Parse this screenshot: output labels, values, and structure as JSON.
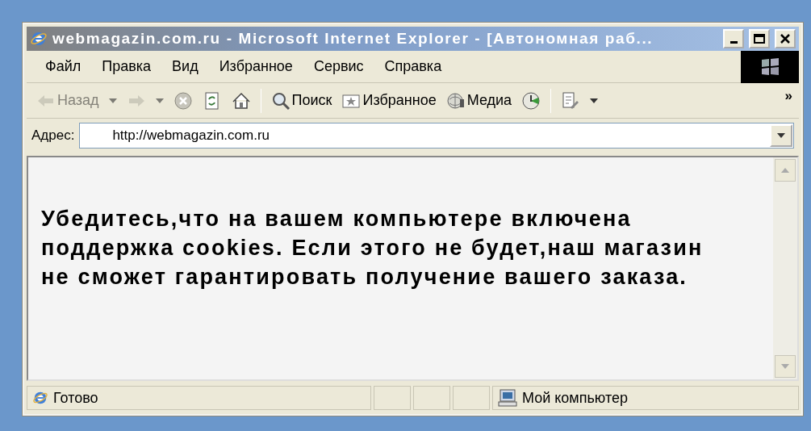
{
  "window": {
    "title": "webmagazin.com.ru - Microsoft Internet Explorer - [Автономная раб..."
  },
  "menu": [
    {
      "label": "Файл"
    },
    {
      "label": "Правка"
    },
    {
      "label": "Вид"
    },
    {
      "label": "Избранное"
    },
    {
      "label": "Сервис"
    },
    {
      "label": "Справка"
    }
  ],
  "toolbar": [
    {
      "kind": "back",
      "label": "Назад",
      "disabled": true
    },
    {
      "kind": "forward",
      "disabled": true
    },
    {
      "kind": "stop",
      "disabled": false
    },
    {
      "kind": "refresh",
      "disabled": false
    },
    {
      "kind": "home",
      "disabled": false
    },
    {
      "kind": "separator"
    },
    {
      "kind": "search",
      "label": "Поиск",
      "disabled": false
    },
    {
      "kind": "favorites",
      "label": "Избранное",
      "disabled": false
    },
    {
      "kind": "media",
      "label": "Медиа",
      "disabled": false
    },
    {
      "kind": "history",
      "disabled": false
    },
    {
      "kind": "separator"
    },
    {
      "kind": "edit",
      "disabled": false
    }
  ],
  "toolbar_overflow": "»",
  "address": {
    "label": "Адрес:",
    "value": "http://webmagazin.com.ru"
  },
  "content": {
    "message": "Убедитесь,что на вашем компьютере включена поддержка cookies. Если этого не будет,наш магазин не сможет гарантировать получение вашего заказа."
  },
  "status_bar": {
    "text": "Готово",
    "zone": "Мой компьютер"
  }
}
